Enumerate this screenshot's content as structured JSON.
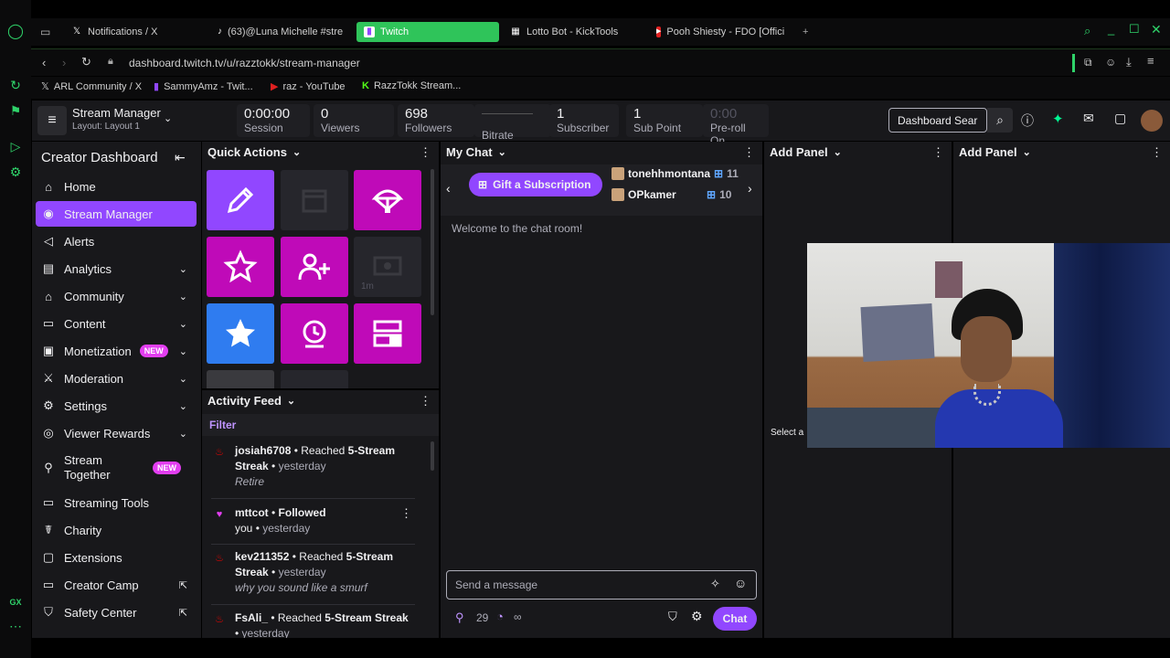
{
  "browser": {
    "tabs": [
      {
        "label": "Notifications / X",
        "icon": "x-icon"
      },
      {
        "label": "(63)@Luna Michelle #stre",
        "icon": "tiktok-icon"
      },
      {
        "label": "Twitch",
        "icon": "twitch-icon"
      },
      {
        "label": "Lotto Bot - KickTools",
        "icon": "grid-icon"
      },
      {
        "label": "Pooh Shiesty - FDO [Offici",
        "icon": "youtube-icon"
      }
    ],
    "url": "dashboard.twitch.tv/u/razztokk/stream-manager",
    "bookmarks": [
      {
        "label": "ARL Community / X",
        "icon": "x-icon"
      },
      {
        "label": "SammyAmz - Twit...",
        "icon": "twitch-icon"
      },
      {
        "label": "raz - YouTube",
        "icon": "youtube-icon"
      },
      {
        "label": "RazzTokk Stream...",
        "icon": "kick-icon"
      }
    ],
    "rail_bottom": "GX"
  },
  "header": {
    "title": "Stream Manager",
    "layout": "Layout: Layout 1",
    "search_placeholder": "Dashboard Sear",
    "stats": [
      {
        "value": "0:00:00",
        "label": "Session"
      },
      {
        "value": "0",
        "label": "Viewers"
      },
      {
        "value": "698",
        "label": "Followers"
      },
      {
        "value": "",
        "label": "Bitrate"
      },
      {
        "value": "1",
        "label": "Subscriber"
      },
      {
        "value": "1",
        "label": "Sub Point"
      },
      {
        "value": "0:00",
        "label": "Pre-roll On"
      }
    ]
  },
  "sidebar": {
    "title": "Creator Dashboard",
    "items": [
      {
        "label": "Home"
      },
      {
        "label": "Stream Manager"
      },
      {
        "label": "Alerts"
      },
      {
        "label": "Analytics"
      },
      {
        "label": "Community"
      },
      {
        "label": "Content"
      },
      {
        "label": "Monetization"
      },
      {
        "label": "Moderation"
      },
      {
        "label": "Settings"
      },
      {
        "label": "Viewer Rewards"
      },
      {
        "label": "Stream Together"
      },
      {
        "label": "Streaming Tools"
      },
      {
        "label": "Charity"
      },
      {
        "label": "Extensions"
      },
      {
        "label": "Creator Camp"
      },
      {
        "label": "Safety Center"
      }
    ],
    "new_badge": "NEW"
  },
  "quick_actions": {
    "title": "Quick Actions",
    "timer_label": "1m"
  },
  "activity_feed": {
    "title": "Activity Feed",
    "filter": "Filter",
    "items": [
      {
        "user": "josiah6708",
        "action": "Reached",
        "bold": "5-Stream Streak",
        "time": "yesterday",
        "note": "Retire"
      },
      {
        "user": "mttcot",
        "action": "Followed",
        "bold": "you",
        "time": "yesterday",
        "note": ""
      },
      {
        "user": "kev211352",
        "action": "Reached",
        "bold": "5-Stream Streak",
        "time": "yesterday",
        "note": "why you sound like a smurf"
      },
      {
        "user": "FsAli_",
        "action": "Reached",
        "bold": "5-Stream Streak",
        "time": "yesterday",
        "note": ""
      }
    ]
  },
  "chat": {
    "title": "My Chat",
    "gift_label": "Gift a Subscription",
    "gifters": [
      {
        "name": "tonehhmontana",
        "count": "11"
      },
      {
        "name": "OPkamer",
        "count": "10"
      }
    ],
    "welcome": "Welcome to the chat room!",
    "input_placeholder": "Send a message",
    "points": "29",
    "infinity": "∞",
    "send_label": "Chat"
  },
  "add_panel": {
    "title": "Add Panel",
    "select_text": "Select a"
  },
  "colors": {
    "accent": "#9147ff",
    "quick_magenta": "#bf0ab8",
    "quick_blue": "#2f7cf0",
    "gx_green": "#2fd36a"
  }
}
